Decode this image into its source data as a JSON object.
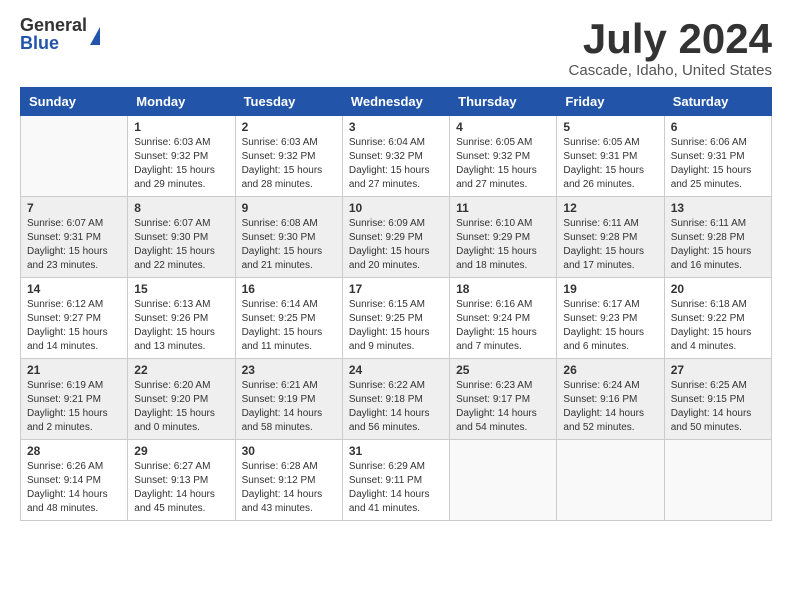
{
  "logo": {
    "general": "General",
    "blue": "Blue"
  },
  "title": "July 2024",
  "location": "Cascade, Idaho, United States",
  "headers": [
    "Sunday",
    "Monday",
    "Tuesday",
    "Wednesday",
    "Thursday",
    "Friday",
    "Saturday"
  ],
  "weeks": [
    [
      {
        "day": "",
        "sunrise": "",
        "sunset": "",
        "daylight": ""
      },
      {
        "day": "1",
        "sunrise": "Sunrise: 6:03 AM",
        "sunset": "Sunset: 9:32 PM",
        "daylight": "Daylight: 15 hours and 29 minutes."
      },
      {
        "day": "2",
        "sunrise": "Sunrise: 6:03 AM",
        "sunset": "Sunset: 9:32 PM",
        "daylight": "Daylight: 15 hours and 28 minutes."
      },
      {
        "day": "3",
        "sunrise": "Sunrise: 6:04 AM",
        "sunset": "Sunset: 9:32 PM",
        "daylight": "Daylight: 15 hours and 27 minutes."
      },
      {
        "day": "4",
        "sunrise": "Sunrise: 6:05 AM",
        "sunset": "Sunset: 9:32 PM",
        "daylight": "Daylight: 15 hours and 27 minutes."
      },
      {
        "day": "5",
        "sunrise": "Sunrise: 6:05 AM",
        "sunset": "Sunset: 9:31 PM",
        "daylight": "Daylight: 15 hours and 26 minutes."
      },
      {
        "day": "6",
        "sunrise": "Sunrise: 6:06 AM",
        "sunset": "Sunset: 9:31 PM",
        "daylight": "Daylight: 15 hours and 25 minutes."
      }
    ],
    [
      {
        "day": "7",
        "sunrise": "Sunrise: 6:07 AM",
        "sunset": "Sunset: 9:31 PM",
        "daylight": "Daylight: 15 hours and 23 minutes."
      },
      {
        "day": "8",
        "sunrise": "Sunrise: 6:07 AM",
        "sunset": "Sunset: 9:30 PM",
        "daylight": "Daylight: 15 hours and 22 minutes."
      },
      {
        "day": "9",
        "sunrise": "Sunrise: 6:08 AM",
        "sunset": "Sunset: 9:30 PM",
        "daylight": "Daylight: 15 hours and 21 minutes."
      },
      {
        "day": "10",
        "sunrise": "Sunrise: 6:09 AM",
        "sunset": "Sunset: 9:29 PM",
        "daylight": "Daylight: 15 hours and 20 minutes."
      },
      {
        "day": "11",
        "sunrise": "Sunrise: 6:10 AM",
        "sunset": "Sunset: 9:29 PM",
        "daylight": "Daylight: 15 hours and 18 minutes."
      },
      {
        "day": "12",
        "sunrise": "Sunrise: 6:11 AM",
        "sunset": "Sunset: 9:28 PM",
        "daylight": "Daylight: 15 hours and 17 minutes."
      },
      {
        "day": "13",
        "sunrise": "Sunrise: 6:11 AM",
        "sunset": "Sunset: 9:28 PM",
        "daylight": "Daylight: 15 hours and 16 minutes."
      }
    ],
    [
      {
        "day": "14",
        "sunrise": "Sunrise: 6:12 AM",
        "sunset": "Sunset: 9:27 PM",
        "daylight": "Daylight: 15 hours and 14 minutes."
      },
      {
        "day": "15",
        "sunrise": "Sunrise: 6:13 AM",
        "sunset": "Sunset: 9:26 PM",
        "daylight": "Daylight: 15 hours and 13 minutes."
      },
      {
        "day": "16",
        "sunrise": "Sunrise: 6:14 AM",
        "sunset": "Sunset: 9:25 PM",
        "daylight": "Daylight: 15 hours and 11 minutes."
      },
      {
        "day": "17",
        "sunrise": "Sunrise: 6:15 AM",
        "sunset": "Sunset: 9:25 PM",
        "daylight": "Daylight: 15 hours and 9 minutes."
      },
      {
        "day": "18",
        "sunrise": "Sunrise: 6:16 AM",
        "sunset": "Sunset: 9:24 PM",
        "daylight": "Daylight: 15 hours and 7 minutes."
      },
      {
        "day": "19",
        "sunrise": "Sunrise: 6:17 AM",
        "sunset": "Sunset: 9:23 PM",
        "daylight": "Daylight: 15 hours and 6 minutes."
      },
      {
        "day": "20",
        "sunrise": "Sunrise: 6:18 AM",
        "sunset": "Sunset: 9:22 PM",
        "daylight": "Daylight: 15 hours and 4 minutes."
      }
    ],
    [
      {
        "day": "21",
        "sunrise": "Sunrise: 6:19 AM",
        "sunset": "Sunset: 9:21 PM",
        "daylight": "Daylight: 15 hours and 2 minutes."
      },
      {
        "day": "22",
        "sunrise": "Sunrise: 6:20 AM",
        "sunset": "Sunset: 9:20 PM",
        "daylight": "Daylight: 15 hours and 0 minutes."
      },
      {
        "day": "23",
        "sunrise": "Sunrise: 6:21 AM",
        "sunset": "Sunset: 9:19 PM",
        "daylight": "Daylight: 14 hours and 58 minutes."
      },
      {
        "day": "24",
        "sunrise": "Sunrise: 6:22 AM",
        "sunset": "Sunset: 9:18 PM",
        "daylight": "Daylight: 14 hours and 56 minutes."
      },
      {
        "day": "25",
        "sunrise": "Sunrise: 6:23 AM",
        "sunset": "Sunset: 9:17 PM",
        "daylight": "Daylight: 14 hours and 54 minutes."
      },
      {
        "day": "26",
        "sunrise": "Sunrise: 6:24 AM",
        "sunset": "Sunset: 9:16 PM",
        "daylight": "Daylight: 14 hours and 52 minutes."
      },
      {
        "day": "27",
        "sunrise": "Sunrise: 6:25 AM",
        "sunset": "Sunset: 9:15 PM",
        "daylight": "Daylight: 14 hours and 50 minutes."
      }
    ],
    [
      {
        "day": "28",
        "sunrise": "Sunrise: 6:26 AM",
        "sunset": "Sunset: 9:14 PM",
        "daylight": "Daylight: 14 hours and 48 minutes."
      },
      {
        "day": "29",
        "sunrise": "Sunrise: 6:27 AM",
        "sunset": "Sunset: 9:13 PM",
        "daylight": "Daylight: 14 hours and 45 minutes."
      },
      {
        "day": "30",
        "sunrise": "Sunrise: 6:28 AM",
        "sunset": "Sunset: 9:12 PM",
        "daylight": "Daylight: 14 hours and 43 minutes."
      },
      {
        "day": "31",
        "sunrise": "Sunrise: 6:29 AM",
        "sunset": "Sunset: 9:11 PM",
        "daylight": "Daylight: 14 hours and 41 minutes."
      },
      {
        "day": "",
        "sunrise": "",
        "sunset": "",
        "daylight": ""
      },
      {
        "day": "",
        "sunrise": "",
        "sunset": "",
        "daylight": ""
      },
      {
        "day": "",
        "sunrise": "",
        "sunset": "",
        "daylight": ""
      }
    ]
  ]
}
